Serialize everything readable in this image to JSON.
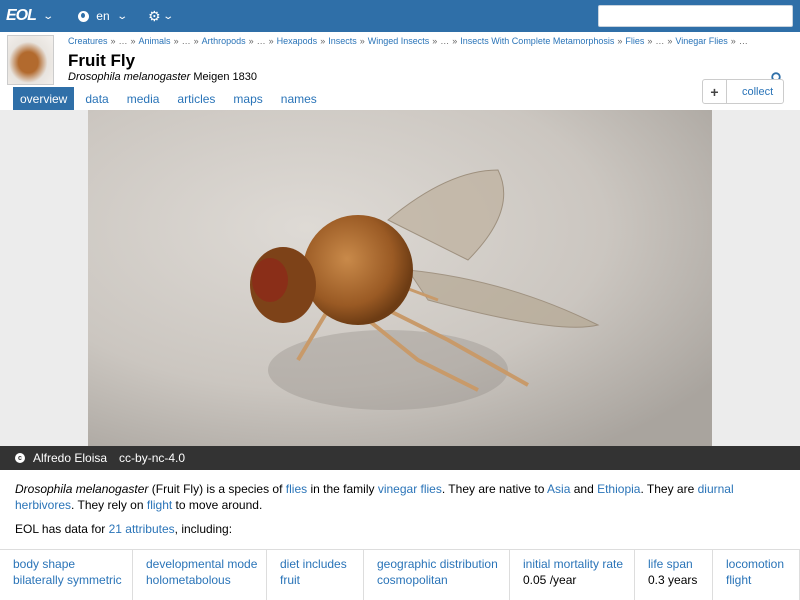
{
  "topbar": {
    "logo": "EOL",
    "language": "en",
    "search_placeholder": ""
  },
  "header": {
    "breadcrumb": [
      "Creatures",
      "…",
      "Animals",
      "…",
      "Arthropods",
      "…",
      "Hexapods",
      "Insects",
      "Winged Insects",
      "…",
      "Insects With Complete Metamorphosis",
      "Flies",
      "…",
      "Vinegar Flies",
      "…"
    ],
    "title": "Fruit Fly",
    "scientific_name": "Drosophila melanogaster",
    "authority": "Meigen 1830",
    "collect_plus": "+",
    "collect_label": "collect"
  },
  "tabs": [
    {
      "label": "overview",
      "active": true
    },
    {
      "label": "data",
      "active": false
    },
    {
      "label": "media",
      "active": false
    },
    {
      "label": "articles",
      "active": false
    },
    {
      "label": "maps",
      "active": false
    },
    {
      "label": "names",
      "active": false
    }
  ],
  "attribution": {
    "cc_icon": "c",
    "author": "Alfredo Eloisa",
    "license": "cc-by-nc-4.0"
  },
  "description": {
    "sci": "Drosophila melanogaster",
    "t1": " (Fruit Fly) is a species of ",
    "l1": "flies",
    "t2": " in the family ",
    "l2": "vinegar flies",
    "t3": ". They are native to ",
    "l3": "Asia",
    "t4": " and ",
    "l4": "Ethiopia",
    "t5": ". They are ",
    "l5": "diurnal herbivores",
    "t6": ". They rely on ",
    "l6": "flight",
    "t7": " to move around."
  },
  "eol_data": {
    "prefix": "EOL has data for ",
    "link": "21 attributes",
    "suffix": ", including:"
  },
  "attributes": [
    {
      "key": "body shape",
      "value": "bilaterally symmetric",
      "link": true
    },
    {
      "key": "developmental mode",
      "value": "holometabolous",
      "link": true
    },
    {
      "key": "diet includes",
      "value": "fruit",
      "link": true
    },
    {
      "key": "geographic distribution",
      "value": "cosmopolitan",
      "link": true
    },
    {
      "key": "initial mortality rate",
      "value": "0.05 /year",
      "link": false
    },
    {
      "key": "life span",
      "value": "0.3 years",
      "link": false
    },
    {
      "key": "locomotion",
      "value": "flight",
      "link": true
    }
  ],
  "colors": {
    "brand": "#2f6fa8",
    "link": "#2a74b8",
    "attribution_bar": "#333333"
  }
}
